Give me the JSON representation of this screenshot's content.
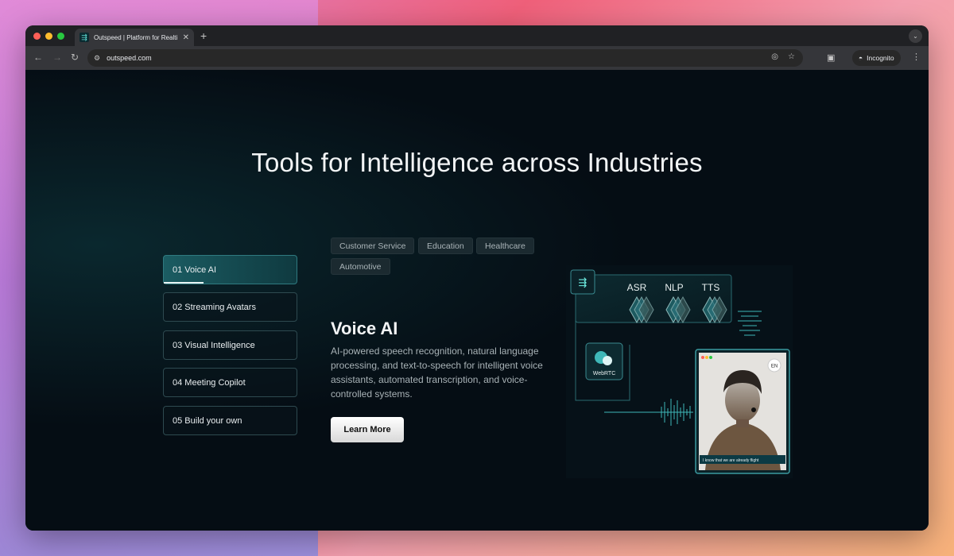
{
  "browser": {
    "tab_title": "Outspeed | Platform for Realti",
    "tab_close": "✕",
    "new_tab": "+",
    "url": "outspeed.com",
    "incognito_label": "Incognito"
  },
  "page": {
    "headline": "Tools for Intelligence across Industries",
    "menu": [
      {
        "label": "01  Voice AI"
      },
      {
        "label": "02  Streaming Avatars"
      },
      {
        "label": "03  Visual Intelligence"
      },
      {
        "label": "04  Meeting Copilot"
      },
      {
        "label": "05  Build your own"
      }
    ],
    "industries": [
      "Customer Service",
      "Education",
      "Healthcare",
      "Automotive"
    ],
    "panel": {
      "title": "Voice AI",
      "description": "AI-powered speech recognition, natural language processing, and text-to-speech for intelligent voice assistants, automated transcription, and voice-controlled systems.",
      "cta": "Learn More"
    },
    "illustration": {
      "stages": [
        "ASR",
        "NLP",
        "TTS"
      ],
      "webrtc_label": "WebRTC",
      "lang_badge": "EN",
      "caption": "I know that we are already flight"
    }
  },
  "colors": {
    "accent_teal": "#2f7a80",
    "page_bg": "#050d14"
  }
}
